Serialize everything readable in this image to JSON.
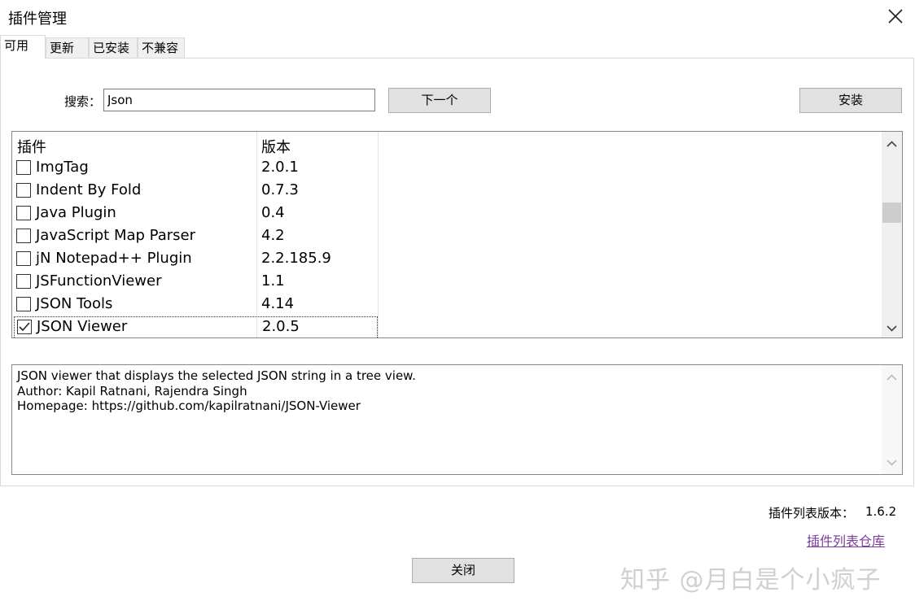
{
  "window": {
    "title": "插件管理"
  },
  "tabs": [
    {
      "label": "可用",
      "active": true
    },
    {
      "label": "更新",
      "active": false
    },
    {
      "label": "已安装",
      "active": false
    },
    {
      "label": "不兼容",
      "active": false
    }
  ],
  "search": {
    "label": "搜索：",
    "value": "Json",
    "next_label": "下一个"
  },
  "install_label": "安装",
  "list": {
    "headers": {
      "plugin": "插件",
      "version": "版本"
    },
    "rows": [
      {
        "name": "ImgTag",
        "version": "2.0.1",
        "checked": false
      },
      {
        "name": "Indent By Fold",
        "version": "0.7.3",
        "checked": false
      },
      {
        "name": "Java Plugin",
        "version": "0.4",
        "checked": false
      },
      {
        "name": "JavaScript Map Parser",
        "version": "4.2",
        "checked": false
      },
      {
        "name": "jN Notepad++ Plugin",
        "version": "2.2.185.9",
        "checked": false
      },
      {
        "name": "JSFunctionViewer",
        "version": "1.1",
        "checked": false
      },
      {
        "name": "JSON Tools",
        "version": "4.14",
        "checked": false
      },
      {
        "name": "JSON Viewer",
        "version": "2.0.5",
        "checked": true
      }
    ]
  },
  "description": {
    "lines": [
      "JSON viewer that displays the selected JSON string in a tree view.",
      "Author: Kapil Ratnani, Rajendra Singh",
      "Homepage: https://github.com/kapilratnani/JSON-Viewer"
    ]
  },
  "footer": {
    "list_version_label": "插件列表版本：",
    "list_version_value": "1.6.2",
    "repo_link": "插件列表仓库",
    "close_label": "关闭"
  },
  "watermark": "知乎 @月白是个小疯子",
  "colors": {
    "link": "#7b3d9b",
    "button_bg": "#e1e1e1",
    "tab_bg": "#f0f0f0"
  }
}
